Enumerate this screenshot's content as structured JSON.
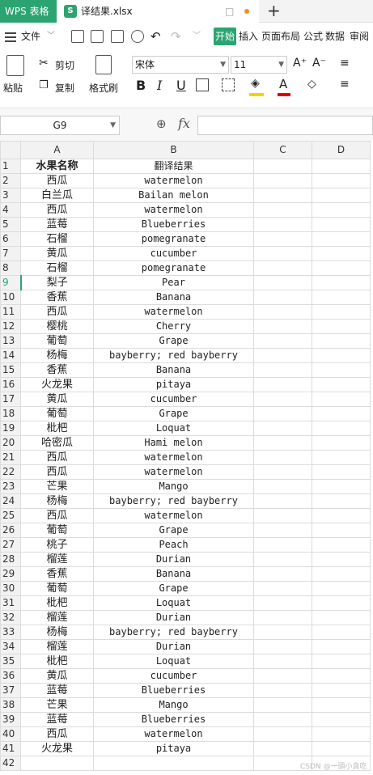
{
  "titlebar": {
    "app_tab": "WPS 表格",
    "file_tab": "译结果.xlsx",
    "file_icon": "S",
    "add": "+",
    "monitor": "□"
  },
  "menu": {
    "file": "文件",
    "start": "开始",
    "insert": "插入",
    "layout": "页面布局",
    "formula": "公式",
    "data": "数据",
    "review": "审阅"
  },
  "ribbon": {
    "paste": "粘贴",
    "cut": "剪切",
    "copy": "复制",
    "format_painter": "格式刷",
    "font": "宋体",
    "size": "11",
    "grow": "A⁺",
    "shrink": "A⁻",
    "bold": "B",
    "italic": "I",
    "underline": "U",
    "fill_color": "#f7d000",
    "font_color": "#e00000"
  },
  "formula_bar": {
    "cell_ref": "G9",
    "fx": "fx",
    "value": ""
  },
  "columns": [
    "A",
    "B",
    "C",
    "D"
  ],
  "sheet": {
    "header": [
      "水果名称",
      "翻译结果"
    ],
    "selected_row": "9",
    "rows": [
      [
        "西瓜",
        "watermelon"
      ],
      [
        "白兰瓜",
        "Bailan melon"
      ],
      [
        "西瓜",
        "watermelon"
      ],
      [
        "蓝莓",
        "Blueberries"
      ],
      [
        "石榴",
        "pomegranate"
      ],
      [
        "黄瓜",
        "cucumber"
      ],
      [
        "石榴",
        "pomegranate"
      ],
      [
        "梨子",
        "Pear"
      ],
      [
        "香蕉",
        "Banana"
      ],
      [
        "西瓜",
        "watermelon"
      ],
      [
        "樱桃",
        "Cherry"
      ],
      [
        "葡萄",
        "Grape"
      ],
      [
        "杨梅",
        "bayberry; red bayberry"
      ],
      [
        "香蕉",
        "Banana"
      ],
      [
        "火龙果",
        "pitaya"
      ],
      [
        "黄瓜",
        "cucumber"
      ],
      [
        "葡萄",
        "Grape"
      ],
      [
        "枇杷",
        "Loquat"
      ],
      [
        "哈密瓜",
        "Hami melon"
      ],
      [
        "西瓜",
        "watermelon"
      ],
      [
        "西瓜",
        "watermelon"
      ],
      [
        "芒果",
        "Mango"
      ],
      [
        "杨梅",
        "bayberry; red bayberry"
      ],
      [
        "西瓜",
        "watermelon"
      ],
      [
        "葡萄",
        "Grape"
      ],
      [
        "桃子",
        "Peach"
      ],
      [
        "榴莲",
        "Durian"
      ],
      [
        "香蕉",
        "Banana"
      ],
      [
        "葡萄",
        "Grape"
      ],
      [
        "枇杷",
        "Loquat"
      ],
      [
        "榴莲",
        "Durian"
      ],
      [
        "杨梅",
        "bayberry; red bayberry"
      ],
      [
        "榴莲",
        "Durian"
      ],
      [
        "枇杷",
        "Loquat"
      ],
      [
        "黄瓜",
        "cucumber"
      ],
      [
        "蓝莓",
        "Blueberries"
      ],
      [
        "芒果",
        "Mango"
      ],
      [
        "蓝莓",
        "Blueberries"
      ],
      [
        "西瓜",
        "watermelon"
      ],
      [
        "火龙果",
        "pitaya"
      ],
      [
        "",
        ""
      ]
    ]
  },
  "watermark": "CSDN @一頭小貪吃"
}
